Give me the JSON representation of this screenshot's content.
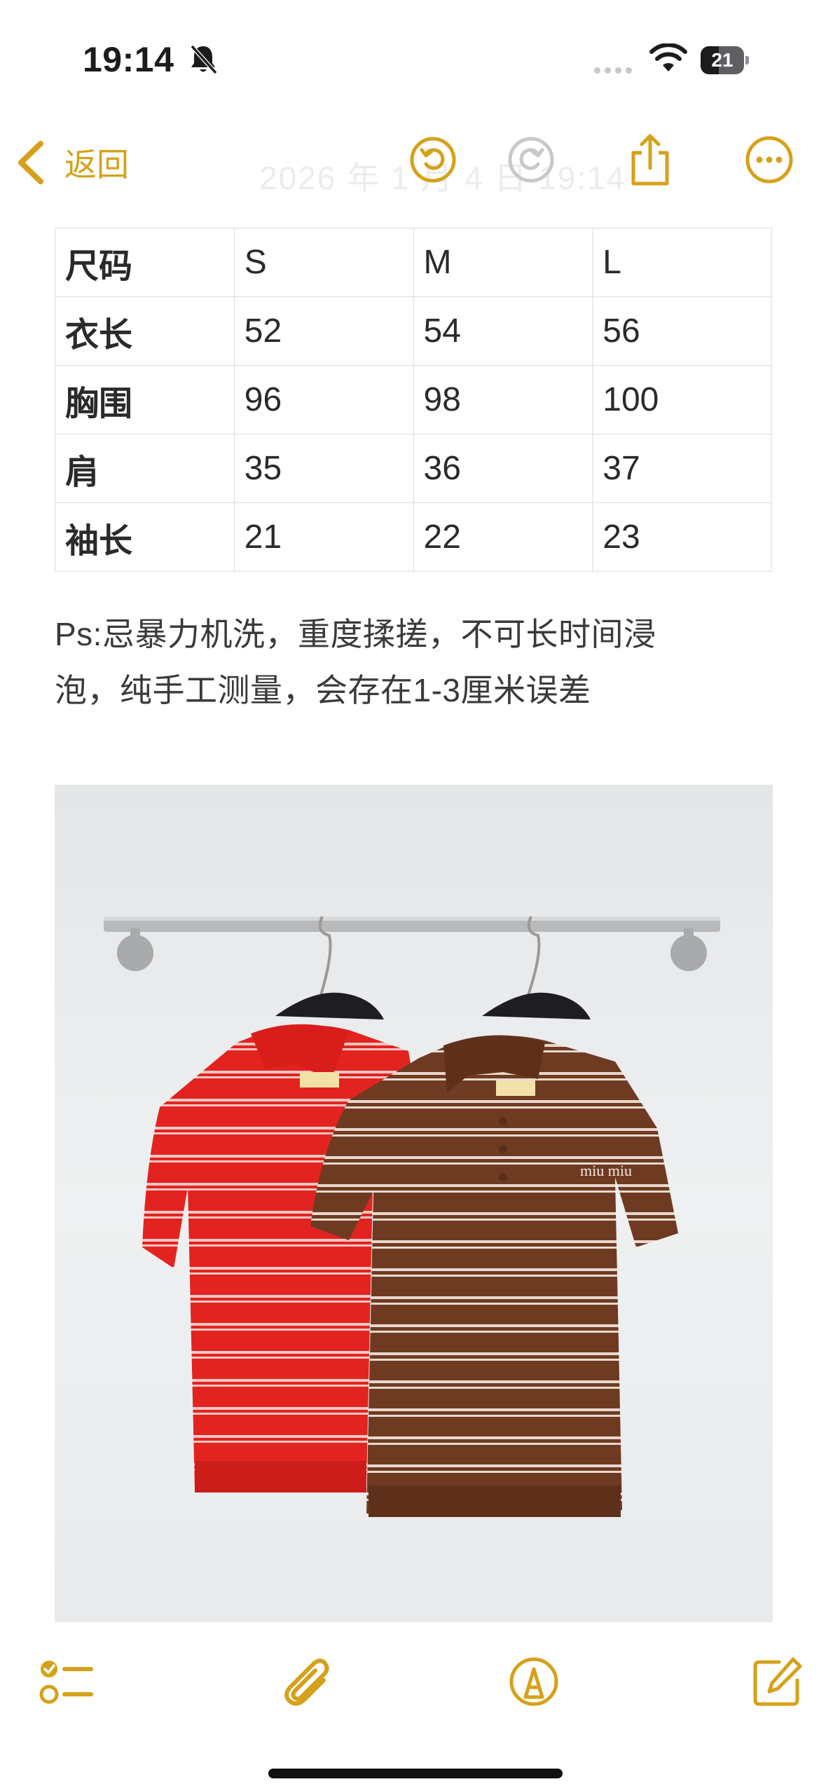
{
  "status_bar": {
    "time": "19:14",
    "battery_level": "21",
    "icons": [
      "bell-slash-icon",
      "signal-dots-icon",
      "wifi-icon",
      "battery-icon"
    ]
  },
  "nav": {
    "back_label": "返回",
    "faded_title": "2026 年 1 月 4 日 19:14",
    "icons": [
      "undo-icon",
      "redo-icon",
      "share-icon",
      "more-icon"
    ],
    "accent_color": "#d6a11a"
  },
  "size_table": {
    "header": [
      "尺码",
      "S",
      "M",
      "L"
    ],
    "rows": [
      {
        "label": "衣长",
        "values": [
          "52",
          "54",
          "56"
        ]
      },
      {
        "label": "胸围",
        "values": [
          "96",
          "98",
          "100"
        ]
      },
      {
        "label": "肩",
        "values": [
          "35",
          "36",
          "37"
        ]
      },
      {
        "label": "袖长",
        "values": [
          "21",
          "22",
          "23"
        ]
      }
    ]
  },
  "note": {
    "line1": "Ps:忌暴力机洗，重度揉搓，不可长时间浸",
    "line2": "泡，纯手工测量，会存在1-3厘米误差"
  },
  "photo": {
    "subject": "two striped knit polo shirts on hangers",
    "shirt_left_color": "#e2231f",
    "shirt_right_color": "#6e3b22",
    "logo_text": "miu miu"
  },
  "toolbar": {
    "icons": [
      "checklist-icon",
      "attachment-icon",
      "markup-icon",
      "compose-icon"
    ]
  }
}
